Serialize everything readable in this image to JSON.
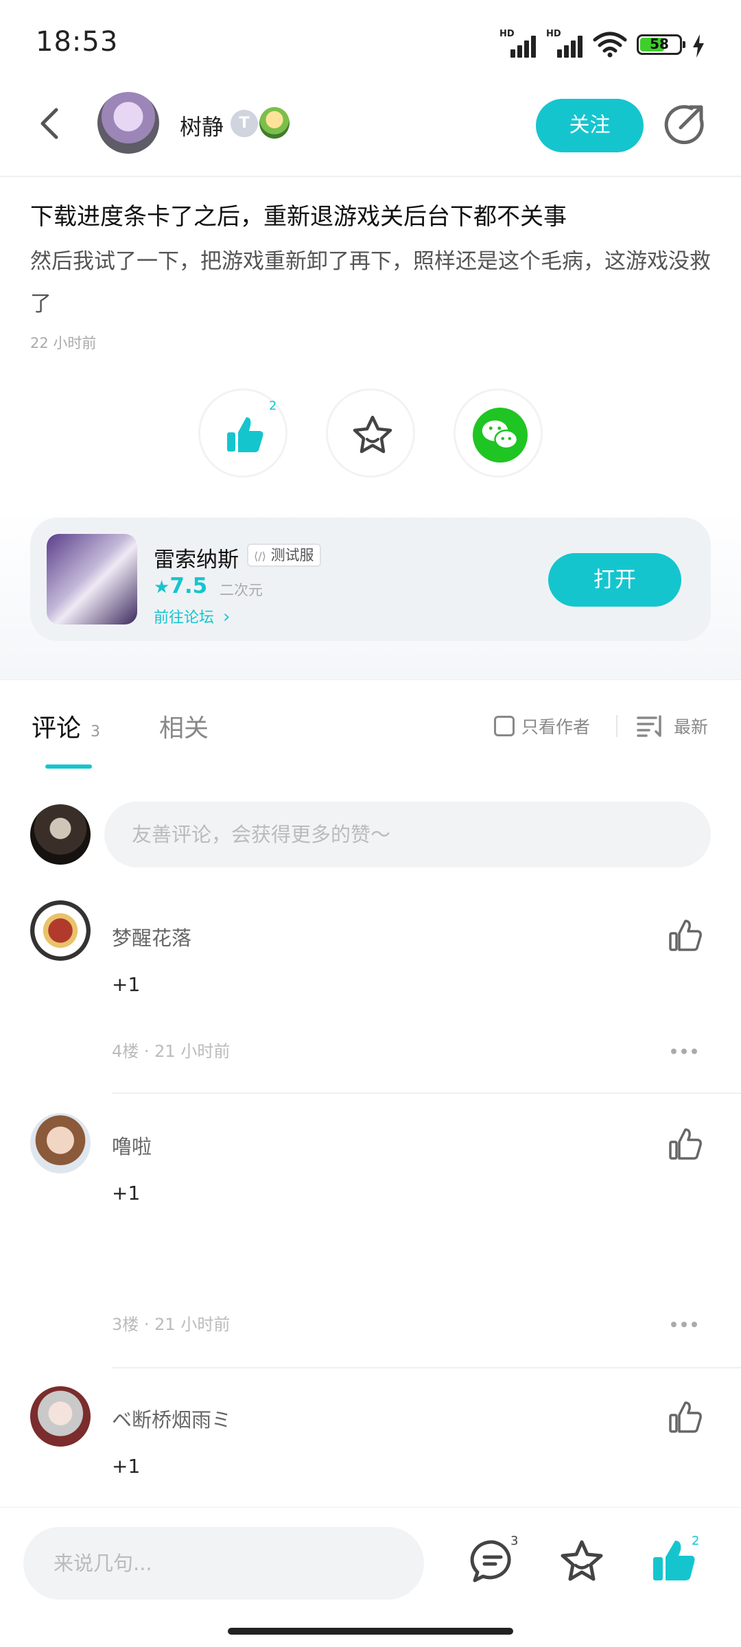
{
  "status_bar": {
    "time": "18:53",
    "battery": "58",
    "signal_label": "HD"
  },
  "header": {
    "author_name": "树静",
    "level_badge": "T",
    "follow_label": "关注"
  },
  "post": {
    "title": "下载进度条卡了之后，重新退游戏关后台下都不关事",
    "body": "然后我试了一下，把游戏重新卸了再下，照样还是这个毛病，这游戏没救了",
    "time": "22 小时前",
    "like_count": "2"
  },
  "game_card": {
    "name": "雷索纳斯",
    "tag": "测试服",
    "rating": "7.5",
    "genre": "二次元",
    "forum_link": "前往论坛",
    "open_label": "打开"
  },
  "tabs": {
    "comments_label": "评论",
    "comments_count": "3",
    "related_label": "相关",
    "only_author_label": "只看作者",
    "sort_label": "最新"
  },
  "comment_input_placeholder": "友善评论，会获得更多的赞～",
  "comments": [
    {
      "name": "梦醒花落",
      "text": "+1",
      "meta": "4楼 · 21 小时前"
    },
    {
      "name": "噜啦",
      "text": "+1",
      "meta": "3楼 · 21 小时前"
    },
    {
      "name": "ベ断桥烟雨ミ",
      "text": "+1",
      "meta": ""
    }
  ],
  "bottom_bar": {
    "placeholder": "来说几句...",
    "comment_count": "3",
    "like_count": "2"
  },
  "colors": {
    "accent": "#15c5ce",
    "wechat": "#1fc522"
  }
}
